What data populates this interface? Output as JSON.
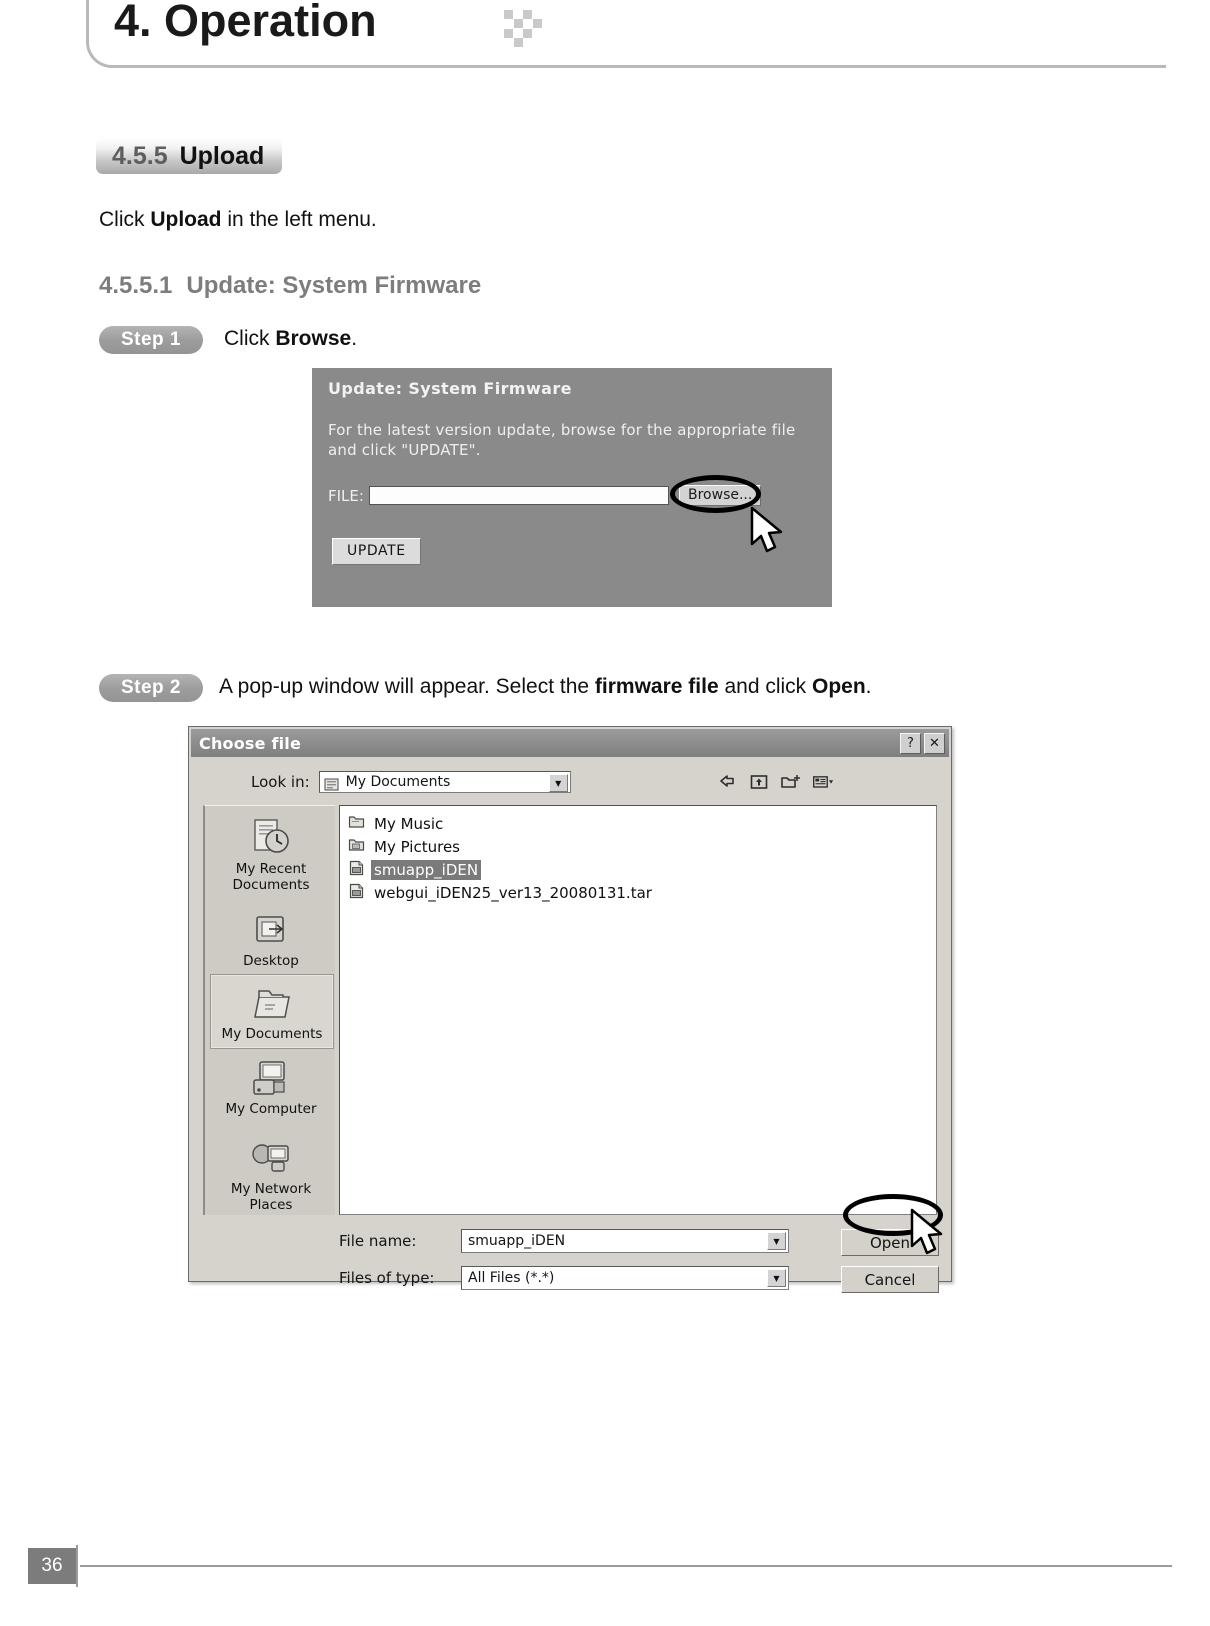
{
  "chapter": {
    "title": "4. Operation"
  },
  "section": {
    "number": "4.5.5",
    "name": "Upload"
  },
  "intro": {
    "before": "Click ",
    "bold": "Upload",
    "after": " in the left menu."
  },
  "subsection": {
    "number": "4.5.5.1",
    "title": "Update: System Firmware"
  },
  "steps": [
    {
      "pill": "Step 1",
      "text_before": "Click ",
      "text_bold": "Browse",
      "text_after": "."
    },
    {
      "pill": "Step 2",
      "text_before": "A pop-up window will appear. Select the ",
      "text_bold": "firmware file",
      "text_mid": " and click ",
      "text_bold2": "Open",
      "text_after": "."
    }
  ],
  "firmware_panel": {
    "title": "Update: System Firmware",
    "description": "For the latest version update, browse for the appropriate file and click \"UPDATE\".",
    "file_label": "FILE:",
    "file_value": "",
    "browse_label": "Browse...",
    "update_label": "UPDATE"
  },
  "choose_file_dialog": {
    "title": "Choose file",
    "help_button": "?",
    "close_button": "✕",
    "lookin_label": "Look in:",
    "lookin_value": "My Documents",
    "toolbar_icons": [
      "back-icon",
      "up-one-level-icon",
      "new-folder-icon",
      "views-icon"
    ],
    "places": [
      {
        "label": "My Recent\nDocuments",
        "icon": "recent-documents-icon",
        "selected": false
      },
      {
        "label": "Desktop",
        "icon": "desktop-icon",
        "selected": false
      },
      {
        "label": "My Documents",
        "icon": "my-documents-icon",
        "selected": true
      },
      {
        "label": "My Computer",
        "icon": "my-computer-icon",
        "selected": false
      },
      {
        "label": "My Network\nPlaces",
        "icon": "network-places-icon",
        "selected": false
      }
    ],
    "files": [
      {
        "name": "My Music",
        "type": "folder",
        "selected": false
      },
      {
        "name": "My Pictures",
        "type": "folder",
        "selected": false
      },
      {
        "name": "smuapp_iDEN",
        "type": "file",
        "selected": true
      },
      {
        "name": "webgui_iDEN25_ver13_20080131.tar",
        "type": "file",
        "selected": false
      }
    ],
    "filename_label": "File name:",
    "filename_value": "smuapp_iDEN",
    "filetype_label": "Files of type:",
    "filetype_value": "All Files (*.*)",
    "open_button": "Open",
    "cancel_button": "Cancel"
  },
  "footer": {
    "page_number": "36"
  },
  "colors": {
    "panel_gray": "#8a8a8a",
    "dialog_face": "#d6d3cd",
    "titlebar": "#8e8e8e",
    "selection": "#7a7a7a",
    "pill_gray": "#9d9d9d",
    "subsection_gray": "#7d7d7d"
  }
}
